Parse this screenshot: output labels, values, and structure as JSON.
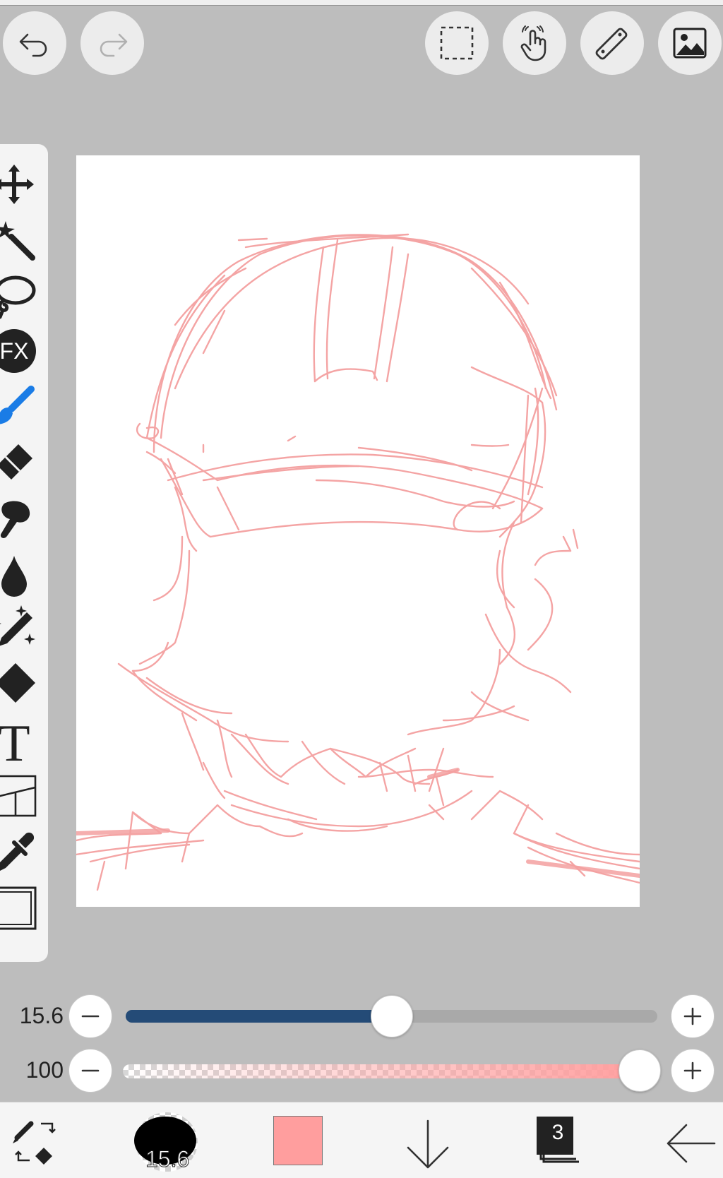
{
  "app": {
    "accent_color": "#1a7ce6",
    "brush_color": "#ff9e9e",
    "sketch_color": "#f4a0a0",
    "slider_fill_color": "#244b77"
  },
  "top_toolbar": {
    "undo_icon": "undo-arrow-icon",
    "redo_icon": "redo-arrow-icon",
    "selection_icon": "dashed-rectangle-icon",
    "touch_icon": "hand-touch-icon",
    "ruler_icon": "ruler-icon",
    "gallery_icon": "image-icon"
  },
  "tools": [
    {
      "name": "move",
      "icon": "move-arrows-icon"
    },
    {
      "name": "magic-wand",
      "icon": "magic-wand-icon"
    },
    {
      "name": "lasso",
      "icon": "lasso-icon"
    },
    {
      "name": "filter",
      "icon": "fx-icon",
      "label": "FX"
    },
    {
      "name": "brush",
      "icon": "brush-icon",
      "active": true
    },
    {
      "name": "eraser",
      "icon": "eraser-icon"
    },
    {
      "name": "smudge",
      "icon": "smudge-finger-icon"
    },
    {
      "name": "fill",
      "icon": "drop-icon"
    },
    {
      "name": "blur",
      "icon": "sparkle-pen-icon"
    },
    {
      "name": "shape",
      "icon": "diamond-icon"
    },
    {
      "name": "text",
      "icon": "text-icon",
      "label": "T"
    },
    {
      "name": "frame-divider",
      "icon": "panels-icon"
    },
    {
      "name": "eyedropper",
      "icon": "eyedropper-icon"
    },
    {
      "name": "canvas",
      "icon": "canvas-frame-icon"
    }
  ],
  "brush_size": {
    "value": "15.6",
    "fraction": 0.5
  },
  "brush_opacity": {
    "value": "100",
    "fraction": 1.0
  },
  "bottom_bar": {
    "swap_icon": "brush-eraser-swap-icon",
    "brush_preview_size": "15.6",
    "layer_count": "3",
    "download_icon": "arrow-down-icon",
    "back_icon": "arrow-left-icon"
  }
}
